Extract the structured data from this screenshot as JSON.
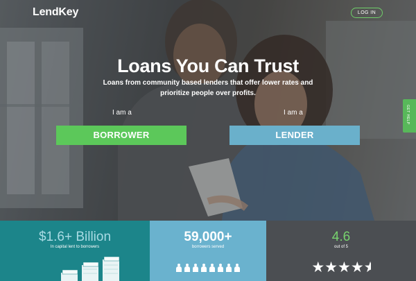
{
  "brand": {
    "logo_text": "LendKey"
  },
  "nav": {
    "login_label": "LOG IN"
  },
  "hero": {
    "title": "Loans You Can Trust",
    "subtitle": "Loans from community based lenders that offer lower rates and prioritize people over profits.",
    "borrower_prefix": "I am a",
    "borrower_button": "BORROWER",
    "lender_prefix": "I am a",
    "lender_button": "LENDER"
  },
  "side_tab": {
    "label": "GET HELP"
  },
  "stats": [
    {
      "value": "$1.6+ Billion",
      "caption": "In capital lent to borrowers"
    },
    {
      "value": "59,000+",
      "caption": "borrowers served"
    },
    {
      "value": "4.6",
      "caption": "out of 5",
      "rating": 4.6,
      "rating_max": 5
    }
  ],
  "colors": {
    "accent_green": "#5cc85a",
    "accent_blue": "#6ab0cb",
    "teal_panel": "#1c858a",
    "dark_panel": "#4b4e52"
  },
  "icons": [
    "people-icon",
    "star-icon",
    "money-stack-icon"
  ]
}
